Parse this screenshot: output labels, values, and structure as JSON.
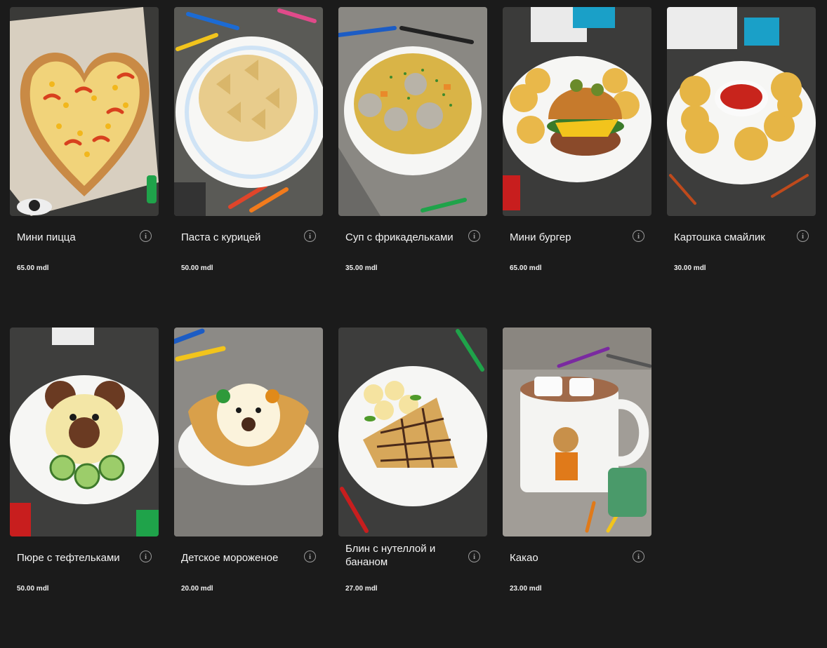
{
  "menu": {
    "items": [
      {
        "name": "Мини пицца",
        "price": "65.00 mdl",
        "image": "mini-pizza-photo",
        "info_icon": "i"
      },
      {
        "name": "Паста с курицей",
        "price": "50.00 mdl",
        "image": "pasta-chicken-photo",
        "info_icon": "i"
      },
      {
        "name": "Суп с фрикадельками",
        "price": "35.00 mdl",
        "image": "meatball-soup-photo",
        "info_icon": "i"
      },
      {
        "name": "Мини бургер",
        "price": "65.00 mdl",
        "image": "mini-burger-photo",
        "info_icon": "i"
      },
      {
        "name": "Картошка смайлик",
        "price": "30.00 mdl",
        "image": "smiley-potato-photo",
        "info_icon": "i"
      },
      {
        "name": "Пюре с тефтельками",
        "price": "50.00 mdl",
        "image": "mashed-potato-meatballs-photo",
        "info_icon": "i"
      },
      {
        "name": "Детское мороженое",
        "price": "20.00 mdl",
        "image": "kids-ice-cream-photo",
        "info_icon": "i"
      },
      {
        "name": "Блин с нутеллой и бананом",
        "price": "27.00 mdl",
        "image": "nutella-banana-crepe-photo",
        "info_icon": "i"
      },
      {
        "name": "Какао",
        "price": "23.00 mdl",
        "image": "cocoa-photo",
        "info_icon": "i"
      }
    ]
  },
  "colors": {
    "background": "#1b1b1b",
    "text": "#ffffff",
    "icon": "#9a9a9a"
  }
}
